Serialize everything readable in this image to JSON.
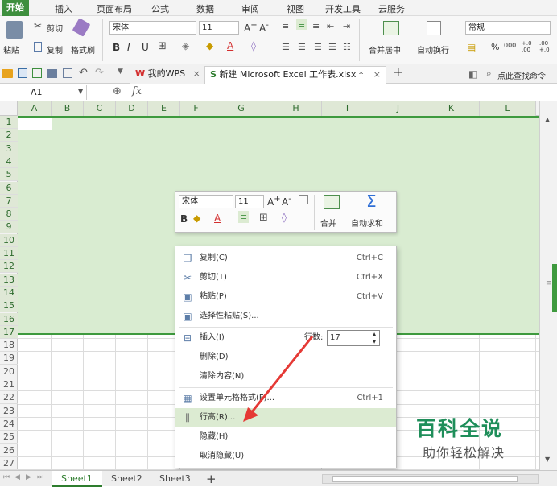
{
  "menu_tabs": [
    "开始",
    "插入",
    "页面布局",
    "公式",
    "数据",
    "审阅",
    "视图",
    "开发工具",
    "云服务"
  ],
  "ribbon": {
    "paste_label": "粘贴",
    "cut_label": "剪切",
    "copy_label": "复制",
    "format_painter_label": "格式刷",
    "font_name": "宋体",
    "font_size": "11",
    "bold": "B",
    "italic": "I",
    "underline": "U",
    "merge_center_label": "合并居中",
    "wrap_label": "自动换行",
    "number_format": "常规",
    "percent": "%",
    "thousand": "000",
    "dec_inc": "+.0 .00",
    "dec_dec": ".00 +.0"
  },
  "doc_tabs": {
    "mywps_label": "我的WPS",
    "file_label": "新建 Microsoft Excel 工作表.xlsx *",
    "add_label": "+",
    "search_label": "点此查找命令"
  },
  "formula_bar": {
    "cell_ref": "A1",
    "fx_label": "fx",
    "value": ""
  },
  "columns": [
    "A",
    "B",
    "C",
    "D",
    "E",
    "F",
    "G",
    "H",
    "I",
    "J",
    "K",
    "L"
  ],
  "rows": [
    "1",
    "2",
    "3",
    "4",
    "5",
    "6",
    "7",
    "8",
    "9",
    "10",
    "11",
    "12",
    "13",
    "14",
    "15",
    "16",
    "17",
    "18",
    "19",
    "20",
    "21",
    "22",
    "23",
    "24",
    "25",
    "26",
    "27"
  ],
  "mini_toolbar": {
    "font_name": "宋体",
    "font_size": "11",
    "bold": "B",
    "merge_label": "合并",
    "autosum_label": "自动求和",
    "sum_glyph": "Σ"
  },
  "context_menu": {
    "items": [
      {
        "label": "复制(C)",
        "shortcut": "Ctrl+C"
      },
      {
        "label": "剪切(T)",
        "shortcut": "Ctrl+X"
      },
      {
        "label": "粘贴(P)",
        "shortcut": "Ctrl+V"
      },
      {
        "label": "选择性粘贴(S)...",
        "shortcut": ""
      },
      {
        "label": "插入(I)",
        "shortcut": ""
      },
      {
        "label": "删除(D)",
        "shortcut": ""
      },
      {
        "label": "清除内容(N)",
        "shortcut": ""
      },
      {
        "label": "设置单元格格式(F)...",
        "shortcut": "Ctrl+1"
      },
      {
        "label": "行高(R)...",
        "shortcut": ""
      },
      {
        "label": "隐藏(H)",
        "shortcut": ""
      },
      {
        "label": "取消隐藏(U)",
        "shortcut": ""
      }
    ],
    "rows_label": "行数:",
    "rows_value": "17"
  },
  "sheets": [
    "Sheet1",
    "Sheet2",
    "Sheet3"
  ],
  "sheet_add": "+",
  "watermark": {
    "title": "百科全说",
    "subtitle": "助你轻松解决"
  },
  "colors": {
    "accent": "#3e8f3e",
    "selection": "#d9ecd1",
    "arrow": "#e53935"
  }
}
